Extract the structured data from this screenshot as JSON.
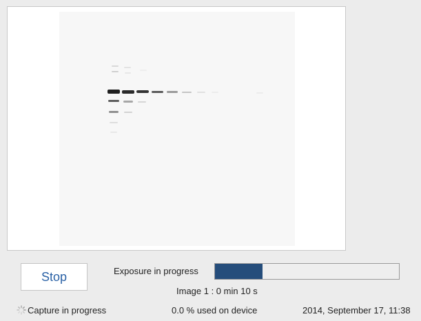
{
  "controls": {
    "stop_label": "Stop",
    "exposure_label": "Exposure in progress",
    "exposure_progress": 0.26,
    "progress_color": "#254d7b",
    "image_time": "Image 1 : 0 min 10 s"
  },
  "status": {
    "capture_label": "Capture in progress",
    "device_usage": "0.0 % used on device",
    "timestamp": "2014, September 17, 11:38"
  },
  "icons": {
    "spinner": "spinner-icon"
  }
}
